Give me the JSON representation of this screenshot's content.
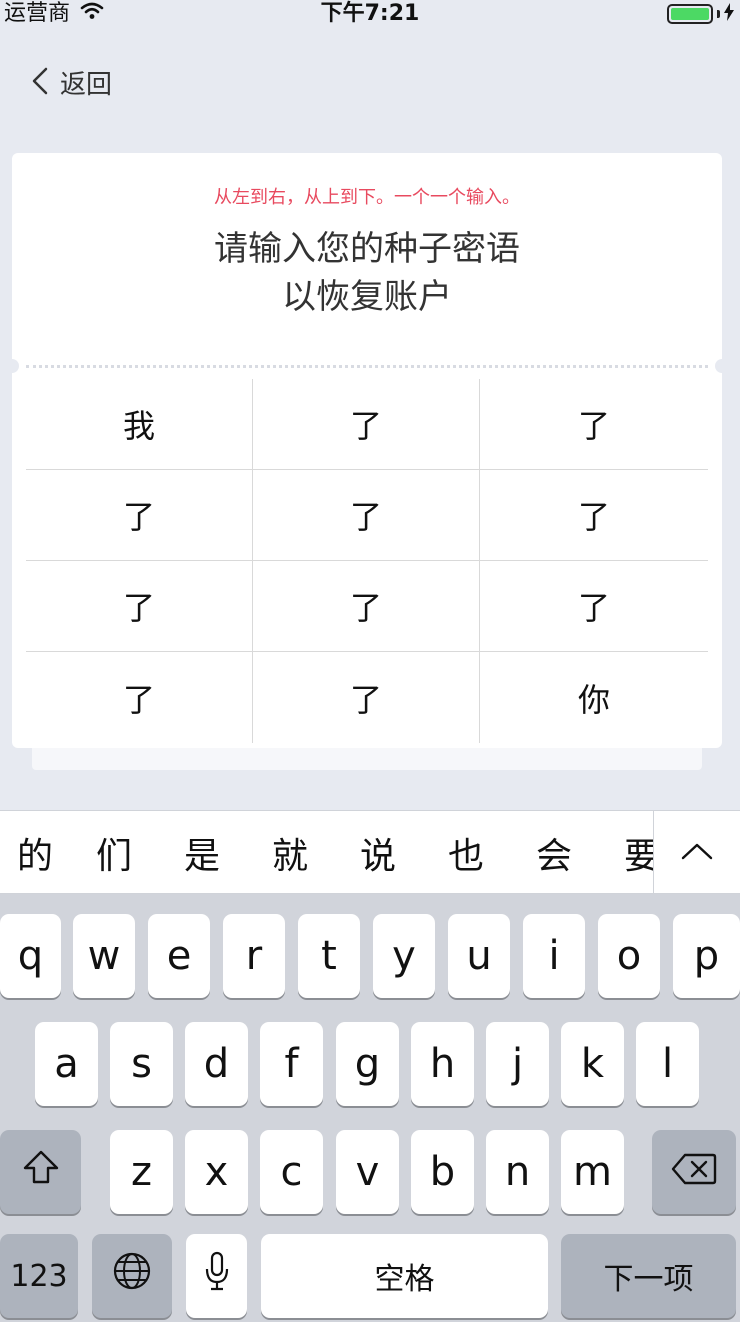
{
  "status_bar": {
    "carrier": "运营商",
    "time": "下午7:21"
  },
  "nav": {
    "back_label": "返回"
  },
  "card": {
    "hint": "从左到右，从上到下。一个一个输入。",
    "title_line1": "请输入您的种子密语",
    "title_line2": "以恢复账户",
    "words": [
      "我",
      "了",
      "了",
      "了",
      "了",
      "了",
      "了",
      "了",
      "了",
      "了",
      "了",
      "你"
    ]
  },
  "candidates": [
    "的",
    "们",
    "是",
    "就",
    "说",
    "也",
    "会",
    "要"
  ],
  "keyboard": {
    "row1": [
      "q",
      "w",
      "e",
      "r",
      "t",
      "y",
      "u",
      "i",
      "o",
      "p"
    ],
    "row2": [
      "a",
      "s",
      "d",
      "f",
      "g",
      "h",
      "j",
      "k",
      "l"
    ],
    "row3": [
      "z",
      "x",
      "c",
      "v",
      "b",
      "n",
      "m"
    ],
    "numbers_label": "123",
    "space_label": "空格",
    "next_label": "下一项"
  },
  "colors": {
    "hint_red": "#e84a5f",
    "battery_green": "#4cd964",
    "background": "#e7eaf1"
  }
}
